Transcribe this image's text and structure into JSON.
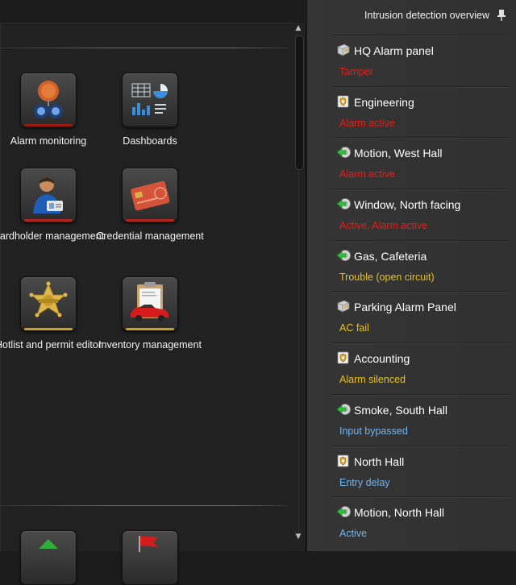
{
  "colors": {
    "accent_blue": "#1a84d8",
    "status_red": "#e0201c",
    "status_yellow": "#e6c21a",
    "status_blue": "#74b4ea"
  },
  "tiles": [
    {
      "label": "Alarm monitoring",
      "icon": "alarm-bell-icon",
      "accent": "#9a1a10"
    },
    {
      "label": "Dashboards",
      "icon": "dashboard-charts-icon",
      "accent": ""
    },
    {
      "label": "Cardholder management",
      "icon": "cardholder-person-icon",
      "accent": "#b3261e"
    },
    {
      "label": "Credential management",
      "icon": "credential-card-icon",
      "accent": "#b3261e"
    },
    {
      "label": "Hotlist and permit editor",
      "icon": "sheriff-star-icon",
      "accent": "#c9a21a"
    },
    {
      "label": "Inventory management",
      "icon": "clipboard-car-icon",
      "accent": "#c9a21a"
    }
  ],
  "panel": {
    "title": "Intrusion detection overview",
    "items": [
      {
        "title": "HQ Alarm panel",
        "status": "Tamper",
        "status_color": "red",
        "icon": "alarm-panel-icon"
      },
      {
        "title": "Engineering",
        "status": "Alarm active",
        "status_color": "red",
        "icon": "area-badge-icon"
      },
      {
        "title": "Motion, West Hall",
        "status": "Alarm active",
        "status_color": "red",
        "icon": "input-arrow-icon"
      },
      {
        "title": "Window, North facing",
        "status": "Active, Alarm active",
        "status_color": "red",
        "icon": "input-arrow-icon"
      },
      {
        "title": "Gas, Cafeteria",
        "status": "Trouble (open circuit)",
        "status_color": "yellow",
        "icon": "input-arrow-icon"
      },
      {
        "title": "Parking Alarm Panel",
        "status": "AC fail",
        "status_color": "yellow",
        "icon": "alarm-panel-icon"
      },
      {
        "title": "Accounting",
        "status": "Alarm silenced",
        "status_color": "yellow",
        "icon": "area-badge-icon"
      },
      {
        "title": "Smoke, South Hall",
        "status": "Input bypassed",
        "status_color": "blue",
        "icon": "input-arrow-icon"
      },
      {
        "title": "North Hall",
        "status": "Entry delay",
        "status_color": "blue",
        "icon": "area-badge-icon"
      },
      {
        "title": "Motion, North Hall",
        "status": "Active",
        "status_color": "blue",
        "icon": "input-arrow-icon"
      }
    ]
  }
}
